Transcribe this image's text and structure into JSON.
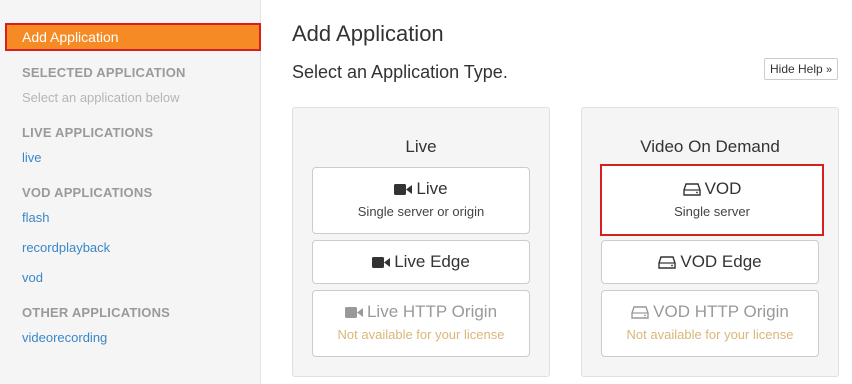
{
  "sidebar": {
    "add_application": "Add Application",
    "selected_header": "SELECTED APPLICATION",
    "selected_hint": "Select an application below",
    "live_header": "LIVE APPLICATIONS",
    "live_apps": [
      "live"
    ],
    "vod_header": "VOD APPLICATIONS",
    "vod_apps": [
      "flash",
      "recordplayback",
      "vod"
    ],
    "other_header": "OTHER APPLICATIONS",
    "other_apps": [
      "videorecording"
    ]
  },
  "main": {
    "title": "Add Application",
    "subtitle": "Select an Application Type.",
    "hide_help": "Hide Help",
    "live_panel": {
      "title": "Live",
      "cards": [
        {
          "name": "Live",
          "desc": "Single server or origin",
          "icon": "video-camera-icon",
          "disabled": false
        },
        {
          "name": "Live Edge",
          "desc": "",
          "icon": "video-camera-icon",
          "disabled": false
        },
        {
          "name": "Live HTTP Origin",
          "desc": "Not available for your license",
          "icon": "video-camera-icon",
          "disabled": true
        }
      ]
    },
    "vod_panel": {
      "title": "Video On Demand",
      "cards": [
        {
          "name": "VOD",
          "desc": "Single server",
          "icon": "hard-drive-icon",
          "disabled": false
        },
        {
          "name": "VOD Edge",
          "desc": "",
          "icon": "hard-drive-icon",
          "disabled": false
        },
        {
          "name": "VOD HTTP Origin",
          "desc": "Not available for your license",
          "icon": "hard-drive-icon",
          "disabled": true
        }
      ]
    }
  },
  "colors": {
    "accent": "#f68a24",
    "highlight_border": "#d62020",
    "link": "#3a87c8",
    "disabled_text": "#d9b77a"
  }
}
